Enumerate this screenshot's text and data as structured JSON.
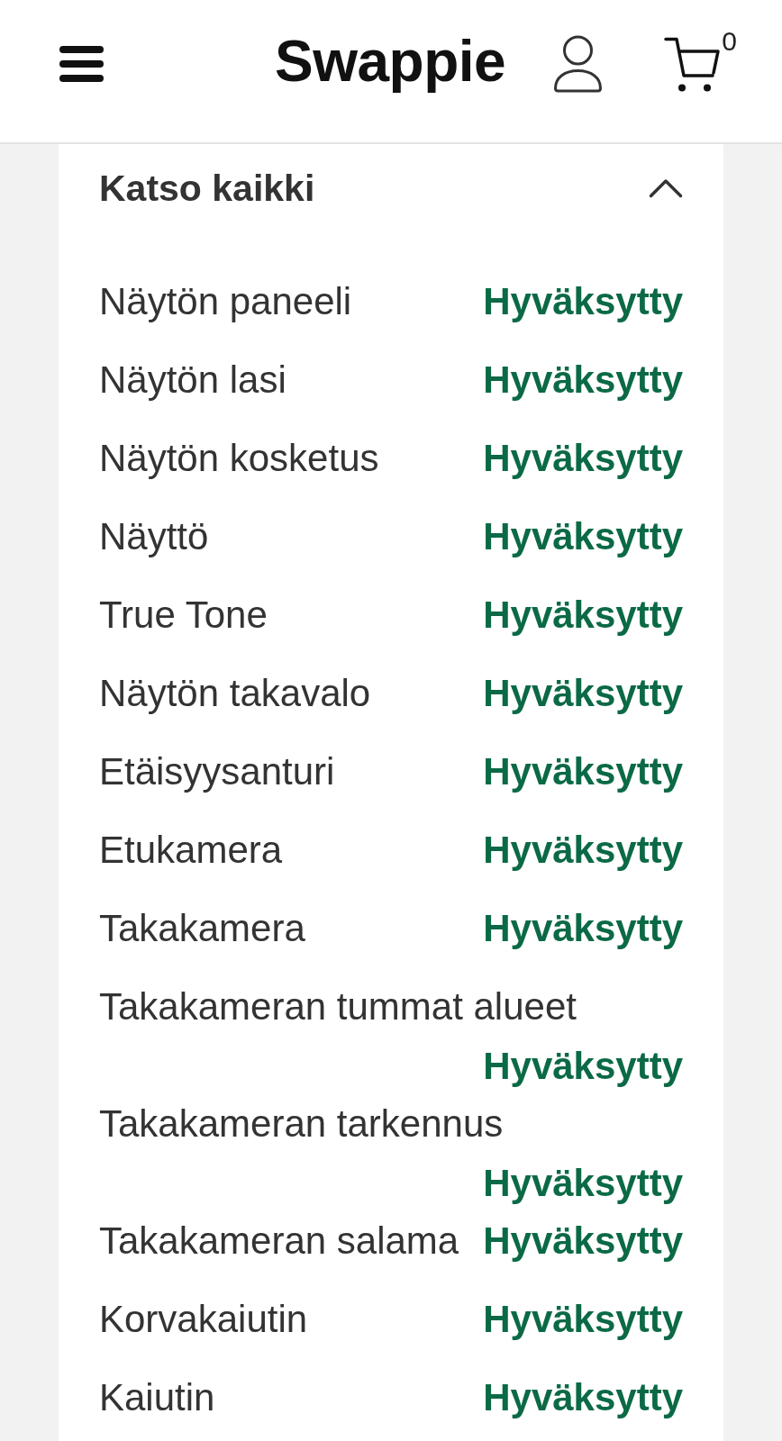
{
  "header": {
    "logo": "Swappie",
    "cart_count": "0"
  },
  "panel": {
    "title": "Katso kaikki",
    "expanded": true,
    "checks": [
      {
        "label": "Näytön paneeli",
        "result": "Hyväksytty"
      },
      {
        "label": "Näytön lasi",
        "result": "Hyväksytty"
      },
      {
        "label": "Näytön kosketus",
        "result": "Hyväksytty"
      },
      {
        "label": "Näyttö",
        "result": "Hyväksytty"
      },
      {
        "label": "True Tone",
        "result": "Hyväksytty"
      },
      {
        "label": "Näytön takavalo",
        "result": "Hyväksytty"
      },
      {
        "label": "Etäisyysanturi",
        "result": "Hyväksytty"
      },
      {
        "label": "Etukamera",
        "result": "Hyväksytty"
      },
      {
        "label": "Takakamera",
        "result": "Hyväksytty"
      },
      {
        "label": "Takakameran tummat alueet",
        "result": "Hyväksytty"
      },
      {
        "label": "Takakameran tarkennus",
        "result": "Hyväksytty"
      },
      {
        "label": "Takakameran salama",
        "result": "Hyväksytty"
      },
      {
        "label": "Korvakaiutin",
        "result": "Hyväksytty"
      },
      {
        "label": "Kaiutin",
        "result": "Hyväksytty"
      }
    ]
  }
}
